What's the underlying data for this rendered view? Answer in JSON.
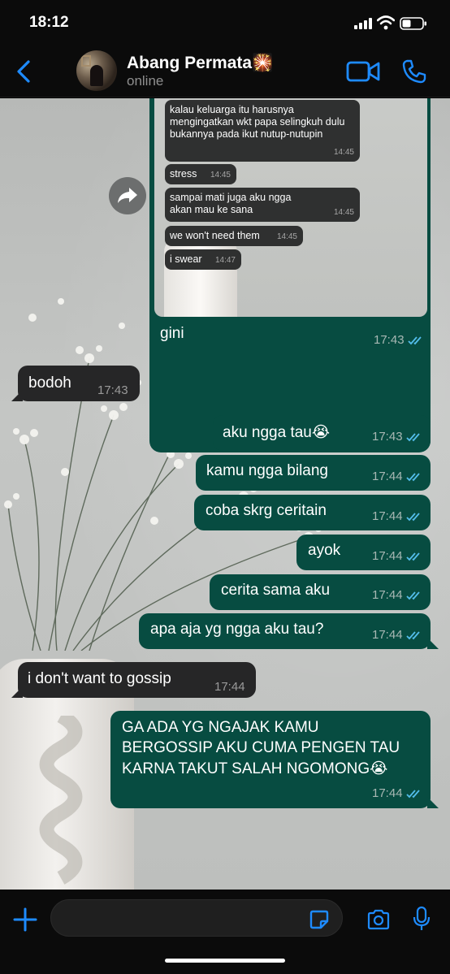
{
  "status_bar": {
    "time": "18:12"
  },
  "header": {
    "contact_name": "Abang Permata🎇",
    "contact_status": "online"
  },
  "quoted_image": {
    "messages": [
      {
        "text": "kalau keluarga itu harusnya mengingatkan wkt papa selingkuh dulu bukannya pada ikut nutup-nutupin",
        "time": "14:45"
      },
      {
        "text": "stress",
        "time": "14:45"
      },
      {
        "text": "sampai mati juga aku ngga akan mau ke sana",
        "time": "14:45"
      },
      {
        "text": "we won't need them",
        "time": "14:45"
      },
      {
        "text": "i swear",
        "time": "14:47"
      }
    ],
    "caption": "gini",
    "time": "17:43"
  },
  "messages": [
    {
      "direction": "in",
      "text": "bodoh",
      "time": "17:43"
    },
    {
      "direction": "out",
      "text": "aku ngga tau😭",
      "time": "17:43"
    },
    {
      "direction": "out",
      "text": "kamu ngga bilang",
      "time": "17:44"
    },
    {
      "direction": "out",
      "text": "coba skrg ceritain",
      "time": "17:44"
    },
    {
      "direction": "out",
      "text": "ayok",
      "time": "17:44"
    },
    {
      "direction": "out",
      "text": "cerita sama aku",
      "time": "17:44"
    },
    {
      "direction": "out",
      "text": "apa aja yg ngga aku tau?",
      "time": "17:44"
    },
    {
      "direction": "in",
      "text": "i don't want to gossip",
      "time": "17:44"
    },
    {
      "direction": "out",
      "lines": [
        "GA ADA YG NGAJAK KAMU",
        "BERGOSSIP AKU CUMA PENGEN TAU",
        "KARNA TAKUT SALAH NGOMONG😭"
      ],
      "time": "17:44"
    }
  ],
  "input": {
    "value": "",
    "placeholder": ""
  },
  "colors": {
    "outgoing_bubble": "#074c41",
    "incoming_bubble": "#262627",
    "accent": "#1e8bff",
    "read_ticks": "#53bdeb"
  },
  "icons": [
    "back-icon",
    "video-call-icon",
    "phone-icon",
    "forward-icon",
    "plus-icon",
    "sticker-icon",
    "camera-icon",
    "microphone-icon"
  ]
}
